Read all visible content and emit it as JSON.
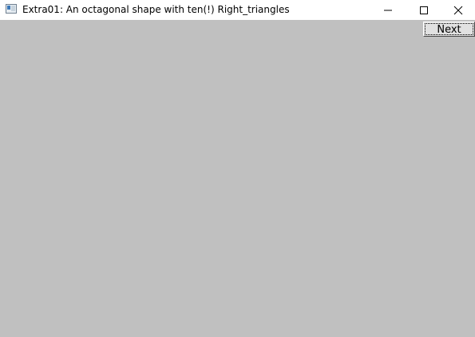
{
  "window": {
    "title": "Extra01: An octagonal shape with ten(!) Right_triangles",
    "app_icon": "window-app-icon",
    "controls": {
      "minimize_icon": "minimize-icon",
      "maximize_icon": "maximize-icon",
      "close_icon": "close-icon"
    }
  },
  "canvas": {
    "background_color": "#c0c0c0"
  },
  "toolbar": {
    "next_label": "Next"
  }
}
